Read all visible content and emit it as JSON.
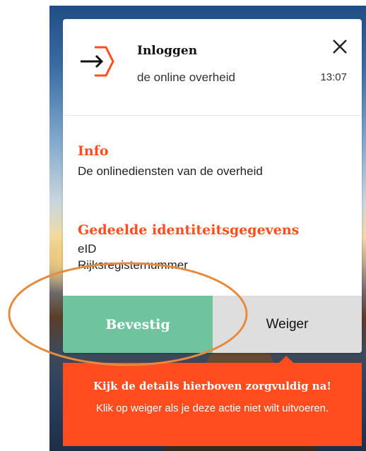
{
  "notification": {
    "title": "Inloggen",
    "subtitle": "de online overheid",
    "time": "13:07",
    "close_icon": "close-icon",
    "logo_icon": "login-arrow-hexagon-icon"
  },
  "info": {
    "heading": "Info",
    "text": "De onlinediensten van de overheid"
  },
  "shared_identity": {
    "heading": "Gedeelde identiteitsgegevens",
    "items": [
      "eID",
      "Rijksregisternummer"
    ]
  },
  "actions": {
    "confirm_label": "Bevestig",
    "decline_label": "Weiger"
  },
  "warning": {
    "title": "Kijk de details hierboven zorgvuldig na!",
    "text": "Klik op weiger als je deze actie niet wilt uitvoeren."
  },
  "colors": {
    "accent": "#ff4d1f",
    "confirm": "#6fc49e",
    "decline": "#dedede",
    "annotation": "#e88a3c"
  }
}
